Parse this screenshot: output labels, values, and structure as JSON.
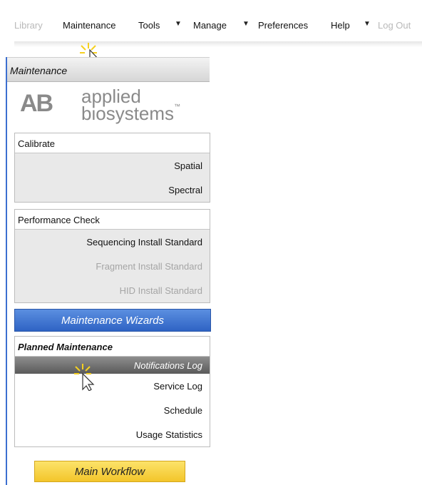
{
  "menu": {
    "items": [
      "Library",
      "Maintenance",
      "Tools",
      "Manage",
      "Preferences",
      "Help",
      "Log Out"
    ],
    "dropdown_arrow": "▼"
  },
  "panel": {
    "title": "Maintenance",
    "logo": {
      "mark": "AB",
      "line1": "applied",
      "line2": "biosystems",
      "tm": "™"
    },
    "calibrate": {
      "heading": "Calibrate",
      "items": [
        "Spatial",
        "Spectral"
      ]
    },
    "performance": {
      "heading": "Performance Check",
      "items": [
        "Sequencing Install Standard",
        "Fragment Install Standard",
        "HID Install Standard"
      ]
    },
    "wizards_label": "Maintenance Wizards",
    "planned": {
      "heading": "Planned Maintenance",
      "items": [
        "Notifications Log",
        "Service Log",
        "Schedule",
        "Usage Statistics"
      ]
    },
    "main_workflow_label": "Main Workflow"
  },
  "colors": {
    "accent": "#3c6fd0",
    "wizards": "#2f63c4",
    "main_workflow": "#f3c52a",
    "cursor_glow": "#f5d020"
  }
}
